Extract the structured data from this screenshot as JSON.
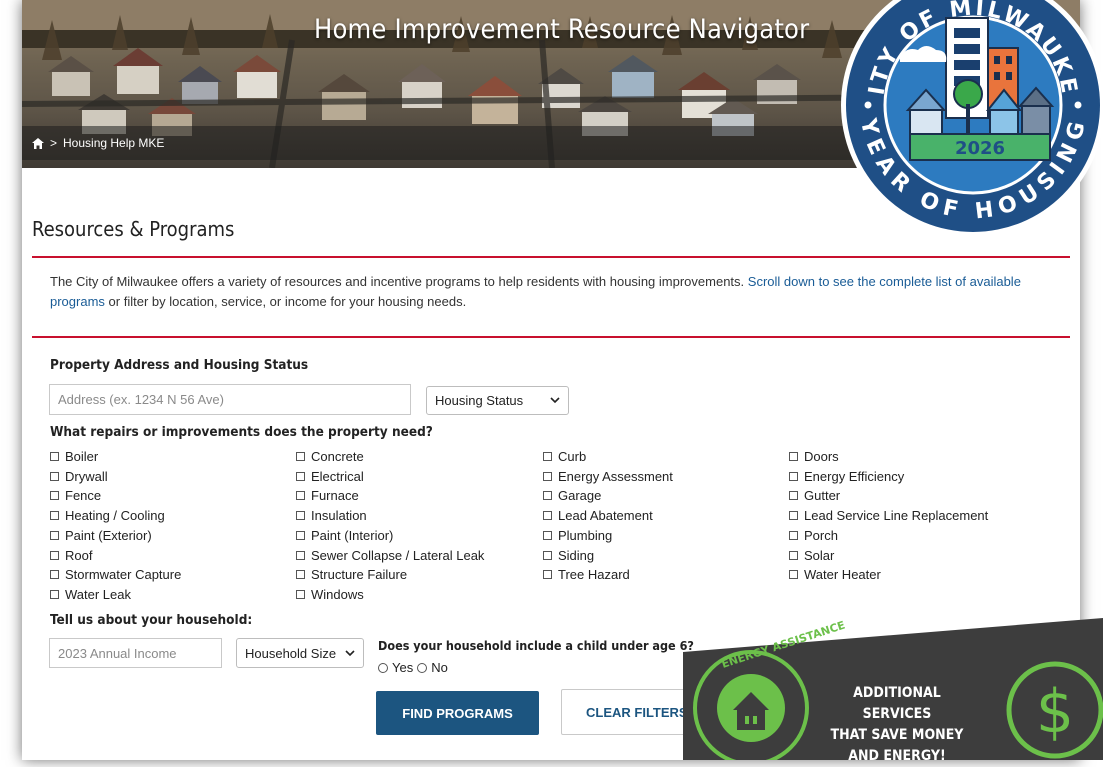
{
  "hero": {
    "title": "Home Improvement Resource Navigator",
    "breadcrumb": {
      "home_icon": "home-icon",
      "separator": ">",
      "current": "Housing Help MKE"
    }
  },
  "seal": {
    "top_text": "CITY OF MILWAUKEE",
    "year": "2026",
    "bottom_text": "YEAR OF HOUSING",
    "colors": {
      "ring": "#1f4f86",
      "ring_inner": "#2d7bc0",
      "tree": "#3aa84a",
      "banner": "#49b26a",
      "year_text": "#1f4f86"
    }
  },
  "section": {
    "title": "Resources & Programs"
  },
  "intro": {
    "text": "The City of Milwaukee offers a variety of resources and incentive programs to help residents with housing improvements.",
    "link": "Scroll down to see the complete list of available programs",
    "after_link": "or filter by location, service, or income for your housing needs."
  },
  "form": {
    "address_section_label": "Property Address and Housing Status",
    "address_placeholder": "Address (ex. 1234 N 56 Ave)",
    "housing_status": "Housing Status",
    "repairs_label": "What repairs or improvements does the property need?",
    "repairs": [
      [
        "Boiler",
        "Drywall",
        "Fence",
        "Heating / Cooling",
        "Paint (Exterior)",
        "Roof",
        "Stormwater Capture",
        "Water Leak"
      ],
      [
        "Concrete",
        "Electrical",
        "Furnace",
        "Insulation",
        "Paint (Interior)",
        "Sewer Collapse / Lateral Leak",
        "Structure Failure",
        "Windows"
      ],
      [
        "Curb",
        "Energy Assessment",
        "Garage",
        "Lead Abatement",
        "Plumbing",
        "Siding",
        "Tree Hazard"
      ],
      [
        "Doors",
        "Energy Efficiency",
        "Gutter",
        "Lead Service Line Replacement",
        "Porch",
        "Solar",
        "Water Heater"
      ]
    ],
    "household_label": "Tell us about your household:",
    "income_placeholder": "2023 Annual Income",
    "household_size": "Household Size",
    "child_question": "Does your household include a child under age 6?",
    "yes_label": "Yes",
    "no_label": "No",
    "find_button": "FIND PROGRAMS",
    "clear_button": "CLEAR FILTERS"
  },
  "promo": {
    "badge_text": "ENERGY ASSISTANCE",
    "line1": "ADDITIONAL SERVICES",
    "line2": "THAT SAVE MONEY",
    "line3": "AND ENERGY!",
    "icons": [
      "house-plug-icon",
      "dollar-icon"
    ],
    "colors": {
      "panel": "#3d3d3d",
      "accent": "#6cc04a"
    }
  },
  "colors": {
    "rule": "#c8102e",
    "link": "#1a5c96",
    "primary_button": "#1c5580"
  }
}
